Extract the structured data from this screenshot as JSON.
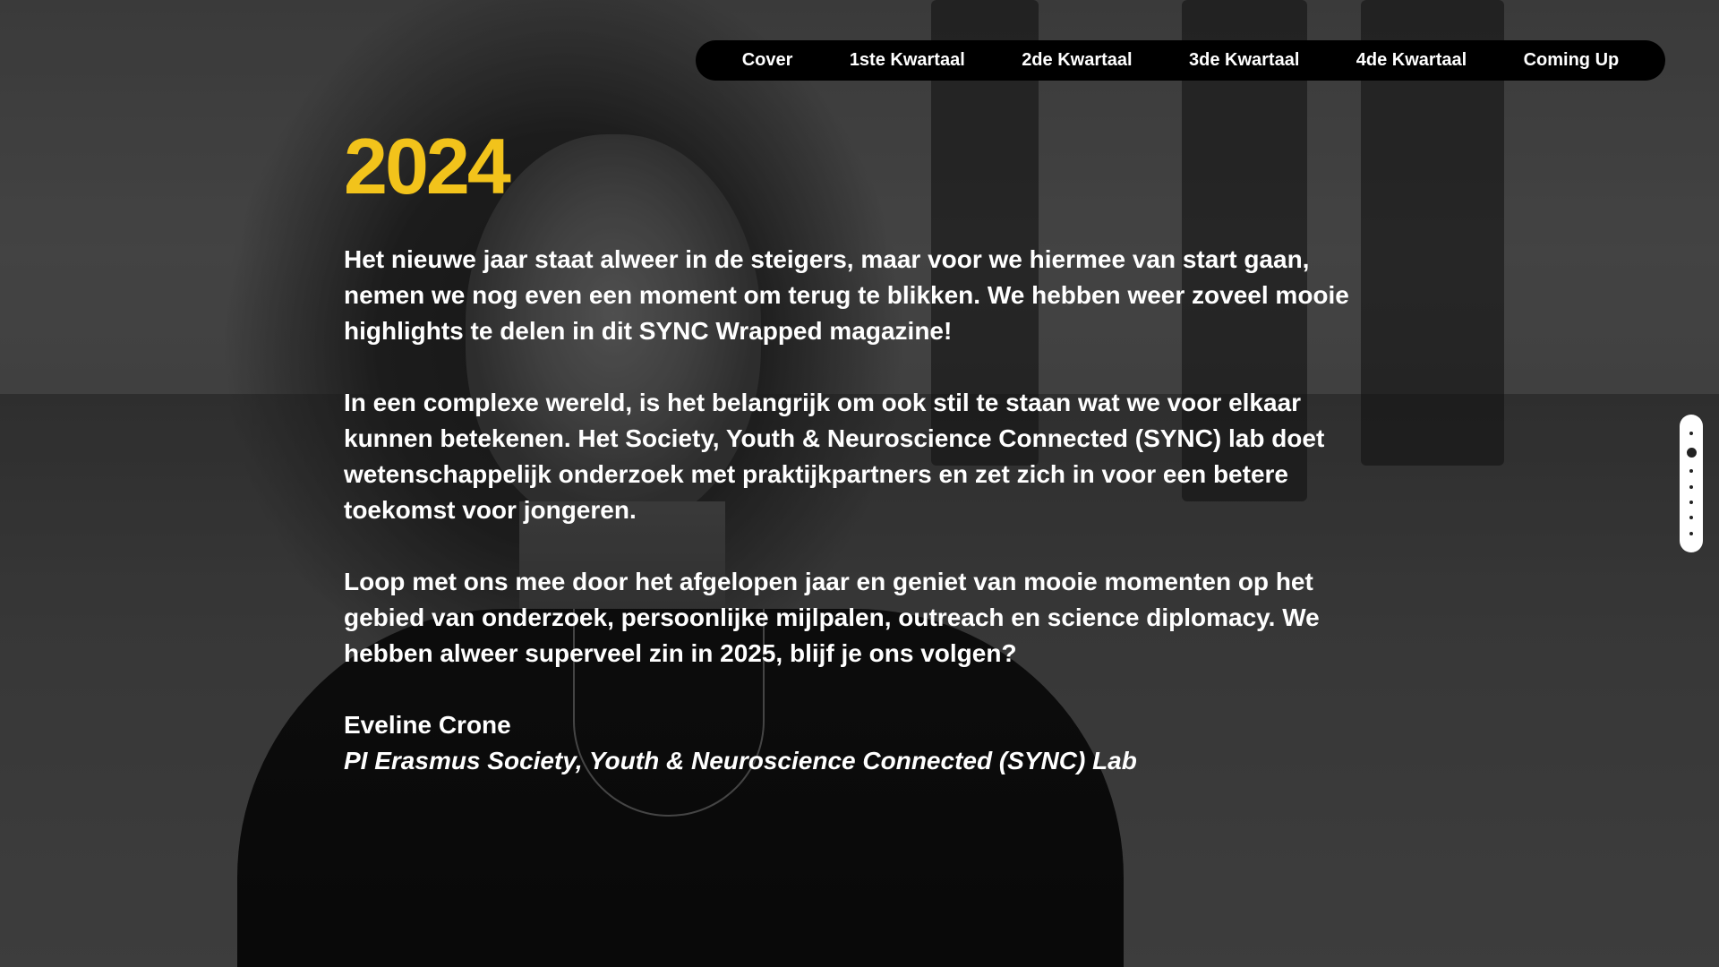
{
  "nav": {
    "items": [
      "Cover",
      "1ste Kwartaal",
      "2de Kwartaal",
      "3de Kwartaal",
      "4de Kwartaal",
      "Coming Up"
    ]
  },
  "main": {
    "year": "2024",
    "paragraphs": [
      "Het nieuwe jaar staat alweer in de steigers, maar voor we hiermee van start gaan, nemen we nog even een moment om terug te blikken. We hebben weer zoveel mooie highlights te delen in dit SYNC Wrapped magazine!",
      "In een complexe wereld, is het belangrijk om ook stil te staan wat we voor elkaar kunnen betekenen. Het Society, Youth & Neuroscience Connected (SYNC) lab doet wetenschappelijk onderzoek met praktijkpartners en zet zich in voor een betere toekomst voor jongeren.",
      "Loop met ons mee door het afgelopen jaar en geniet van mooie momenten op het gebied van onderzoek, persoonlijke mijlpalen, outreach en science diplomacy. We hebben alweer superveel zin in 2025, blijf je ons volgen?"
    ],
    "signature_name": "Eveline Crone",
    "signature_role": "PI Erasmus Society, Youth & Neuroscience Connected (SYNC) Lab"
  },
  "scroll_indicator": {
    "sections": 7,
    "active_index": 1
  },
  "colors": {
    "accent": "#f2c31b",
    "nav_bg": "#000000",
    "text": "#ffffff"
  }
}
